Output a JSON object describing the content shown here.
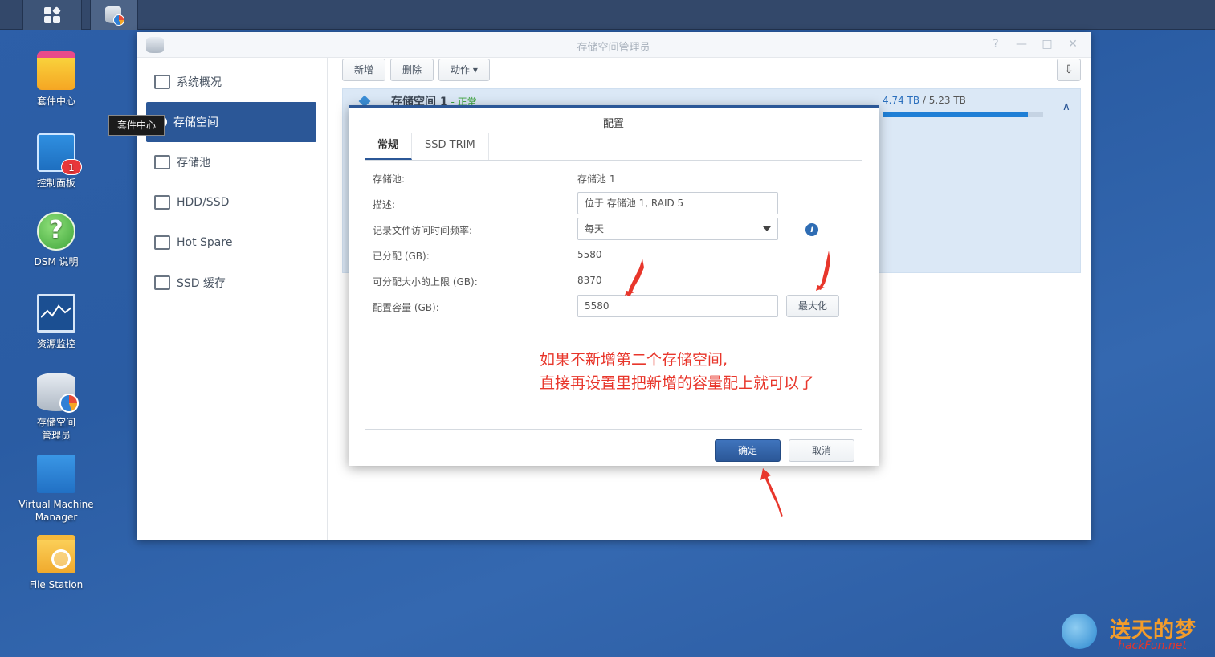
{
  "desktop": {
    "icons": [
      {
        "label": "套件中心"
      },
      {
        "label": "控制面板",
        "badge": "1"
      },
      {
        "label": "DSM 说明"
      },
      {
        "label": "资源监控"
      },
      {
        "label": "存储空间\n管理员"
      },
      {
        "label": "Virtual Machine\nManager"
      },
      {
        "label": "File Station"
      }
    ],
    "tooltip": "套件中心"
  },
  "window": {
    "title": "存储空间管理员",
    "controls": [
      "?",
      "—",
      "□",
      "✕"
    ],
    "sidebar": [
      {
        "label": "系统概况",
        "icon": "overview-icon"
      },
      {
        "label": "存储空间",
        "icon": "volume-icon",
        "active": true
      },
      {
        "label": "存储池",
        "icon": "storage-pool-icon"
      },
      {
        "label": "HDD/SSD",
        "icon": "disk-icon"
      },
      {
        "label": "Hot Spare",
        "icon": "hot-spare-icon"
      },
      {
        "label": "SSD 缓存",
        "icon": "ssd-cache-icon"
      }
    ],
    "toolbar": {
      "create": "新增",
      "remove": "删除",
      "action": "动作 ▾",
      "sort": "⇩"
    },
    "volume": {
      "name": "存储空间 1",
      "sep": " - ",
      "status": "正常",
      "used": "4.74 TB",
      "slash": " / ",
      "total": "5.23 TB",
      "usage_fraction": 0.906,
      "chevron": "∧"
    }
  },
  "dialog": {
    "title": "配置",
    "tabs": [
      "常规",
      "SSD TRIM"
    ],
    "rows": [
      {
        "label": "存储池:",
        "value": "存储池 1"
      },
      {
        "label": "描述:",
        "value": "位于 存储池 1, RAID 5"
      },
      {
        "label": "记录文件访问时间频率:",
        "value": "每天"
      },
      {
        "label": "已分配 (GB):",
        "value": "5580"
      },
      {
        "label": "可分配大小的上限 (GB):",
        "value": "8370"
      },
      {
        "label": "配置容量 (GB):",
        "value": "5580"
      }
    ],
    "info_icon": "i",
    "max_button": "最大化",
    "annotation_line1": "如果不新增第二个存储空间,",
    "annotation_line2": "直接再设置里把新增的容量配上就可以了",
    "ok": "确定",
    "cancel": "取消"
  },
  "watermark": {
    "text": "送天的梦",
    "url": "hackFun.net"
  },
  "colors": {
    "accent": "#2b5797",
    "annotation": "#e8362b",
    "desktop": "#2d5fa8"
  }
}
